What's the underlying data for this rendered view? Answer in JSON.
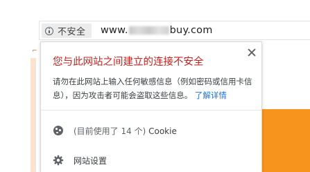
{
  "omnibox": {
    "security_label": "不安全",
    "url_prefix": "www.",
    "url_suffix": "buy.com"
  },
  "popup": {
    "title": "您与此网站之间建立的连接不安全",
    "description": "请勿在此网站上输入任何敏感信息（例如密码或信用卡信息），因为攻击者可能会盗取这些信息。",
    "learn_more": "了解详情",
    "cookies": {
      "count_text": "(目前使用了 14 个)",
      "label": "Cookie"
    },
    "site_settings": {
      "label": "网站设置"
    }
  },
  "colors": {
    "title_red": "#c5221f",
    "link_blue": "#1a73e8",
    "page_orange": "#f7941d"
  }
}
